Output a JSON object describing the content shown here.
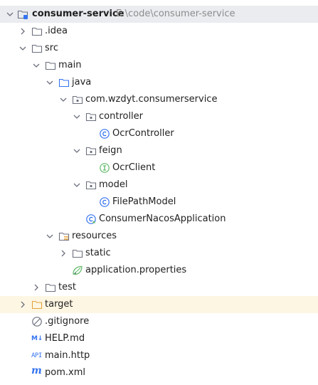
{
  "project": {
    "name": "consumer-service",
    "path": "E:\\code\\consumer-service"
  },
  "items": [
    {
      "label": ".idea"
    },
    {
      "label": "src"
    },
    {
      "label": "main"
    },
    {
      "label": "java"
    },
    {
      "label": "com.wzdyt.consumerservice"
    },
    {
      "label": "controller"
    },
    {
      "label": "OcrController"
    },
    {
      "label": "feign"
    },
    {
      "label": "OcrClient"
    },
    {
      "label": "model"
    },
    {
      "label": "FilePathModel"
    },
    {
      "label": "ConsumerNacosApplication"
    },
    {
      "label": "resources"
    },
    {
      "label": "static"
    },
    {
      "label": "application.properties"
    },
    {
      "label": "test"
    },
    {
      "label": "target"
    },
    {
      "label": ".gitignore"
    },
    {
      "label": "HELP.md"
    },
    {
      "label": "main.http"
    },
    {
      "label": "pom.xml"
    }
  ],
  "icon_labels": {
    "markdown": "M↓",
    "http": "API",
    "maven": "m"
  },
  "colors": {
    "selection": "#ebecf0",
    "excluded_bg": "#fdf6e3",
    "folder": "#6c707e",
    "source_folder": "#3574f0",
    "class_icon": "#3574f0",
    "interface_icon": "#5fb865",
    "excluded_folder": "#e6a23c",
    "path_text": "#8c8c8c"
  }
}
